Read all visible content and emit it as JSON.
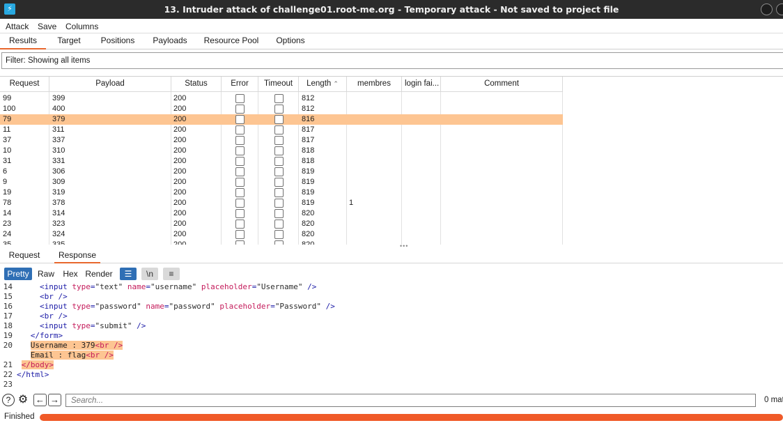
{
  "window": {
    "title": "13. Intruder attack of challenge01.root-me.org - Temporary attack - Not saved to project file",
    "app_icon": "⚡"
  },
  "menu": [
    "Attack",
    "Save",
    "Columns"
  ],
  "tabs": [
    "Results",
    "Target",
    "Positions",
    "Payloads",
    "Resource Pool",
    "Options"
  ],
  "filter": {
    "label": "Filter: Showing all items"
  },
  "table": {
    "columns": [
      "Request",
      "Payload",
      "Status",
      "Error",
      "Timeout",
      "Length",
      "membres",
      "login fai...",
      "Comment"
    ],
    "sort_column": "Length",
    "sort_direction": "ascending",
    "rows": [
      {
        "request": "99",
        "payload": "399",
        "status": "200",
        "error": false,
        "timeout": false,
        "length": "812",
        "membres": "",
        "login": "",
        "comment": ""
      },
      {
        "request": "100",
        "payload": "400",
        "status": "200",
        "error": false,
        "timeout": false,
        "length": "812",
        "membres": "",
        "login": "",
        "comment": ""
      },
      {
        "request": "79",
        "payload": "379",
        "status": "200",
        "error": false,
        "timeout": false,
        "length": "816",
        "membres": "",
        "login": "",
        "comment": "",
        "selected": true
      },
      {
        "request": "11",
        "payload": "311",
        "status": "200",
        "error": false,
        "timeout": false,
        "length": "817",
        "membres": "",
        "login": "",
        "comment": ""
      },
      {
        "request": "37",
        "payload": "337",
        "status": "200",
        "error": false,
        "timeout": false,
        "length": "817",
        "membres": "",
        "login": "",
        "comment": ""
      },
      {
        "request": "10",
        "payload": "310",
        "status": "200",
        "error": false,
        "timeout": false,
        "length": "818",
        "membres": "",
        "login": "",
        "comment": ""
      },
      {
        "request": "31",
        "payload": "331",
        "status": "200",
        "error": false,
        "timeout": false,
        "length": "818",
        "membres": "",
        "login": "",
        "comment": ""
      },
      {
        "request": "6",
        "payload": "306",
        "status": "200",
        "error": false,
        "timeout": false,
        "length": "819",
        "membres": "",
        "login": "",
        "comment": ""
      },
      {
        "request": "9",
        "payload": "309",
        "status": "200",
        "error": false,
        "timeout": false,
        "length": "819",
        "membres": "",
        "login": "",
        "comment": ""
      },
      {
        "request": "19",
        "payload": "319",
        "status": "200",
        "error": false,
        "timeout": false,
        "length": "819",
        "membres": "",
        "login": "",
        "comment": ""
      },
      {
        "request": "78",
        "payload": "378",
        "status": "200",
        "error": false,
        "timeout": false,
        "length": "819",
        "membres": "1",
        "login": "",
        "comment": ""
      },
      {
        "request": "14",
        "payload": "314",
        "status": "200",
        "error": false,
        "timeout": false,
        "length": "820",
        "membres": "",
        "login": "",
        "comment": ""
      },
      {
        "request": "23",
        "payload": "323",
        "status": "200",
        "error": false,
        "timeout": false,
        "length": "820",
        "membres": "",
        "login": "",
        "comment": ""
      },
      {
        "request": "24",
        "payload": "324",
        "status": "200",
        "error": false,
        "timeout": false,
        "length": "820",
        "membres": "",
        "login": "",
        "comment": ""
      },
      {
        "request": "35",
        "payload": "335",
        "status": "200",
        "error": false,
        "timeout": false,
        "length": "820",
        "membres": "",
        "login": "",
        "comment": ""
      }
    ]
  },
  "detail_tabs": [
    "Request",
    "Response"
  ],
  "view_modes": [
    "Pretty",
    "Raw",
    "Hex",
    "Render"
  ],
  "view_icons": [
    "wrap-lines-icon",
    "newline-icon",
    "menu-icon"
  ],
  "view_icon_glyphs": [
    "☰",
    "\\n",
    "≡"
  ],
  "code_lines": [
    {
      "n": "14",
      "indent": "     ",
      "segments": [
        [
          "tag",
          "<input "
        ],
        [
          "attr",
          "type"
        ],
        [
          "tag",
          "="
        ],
        [
          "str",
          "\"text\" "
        ],
        [
          "attr",
          "name"
        ],
        [
          "tag",
          "="
        ],
        [
          "str",
          "\"username\" "
        ],
        [
          "attr",
          "placeholder"
        ],
        [
          "tag",
          "="
        ],
        [
          "str",
          "\"Username\" "
        ],
        [
          "tag",
          "/>"
        ]
      ]
    },
    {
      "n": "15",
      "indent": "     ",
      "segments": [
        [
          "tag",
          "<br />"
        ]
      ]
    },
    {
      "n": "16",
      "indent": "     ",
      "segments": [
        [
          "tag",
          "<input "
        ],
        [
          "attr",
          "type"
        ],
        [
          "tag",
          "="
        ],
        [
          "str",
          "\"password\" "
        ],
        [
          "attr",
          "name"
        ],
        [
          "tag",
          "="
        ],
        [
          "str",
          "\"password\" "
        ],
        [
          "attr",
          "placeholder"
        ],
        [
          "tag",
          "="
        ],
        [
          "str",
          "\"Password\" "
        ],
        [
          "tag",
          "/>"
        ]
      ]
    },
    {
      "n": "17",
      "indent": "     ",
      "segments": [
        [
          "tag",
          "<br />"
        ]
      ]
    },
    {
      "n": "18",
      "indent": "     ",
      "segments": [
        [
          "tag",
          "<input "
        ],
        [
          "attr",
          "type"
        ],
        [
          "tag",
          "="
        ],
        [
          "str",
          "\"submit\" "
        ],
        [
          "tag",
          "/>"
        ]
      ]
    },
    {
      "n": "19",
      "indent": "   ",
      "segments": [
        [
          "tag",
          "</form>"
        ]
      ]
    },
    {
      "n": "20",
      "indent": "   ",
      "highlight": true,
      "segments": [
        [
          "txt",
          "Username : 379"
        ],
        [
          "attr",
          "<br />"
        ]
      ]
    },
    {
      "n": "",
      "indent": "   ",
      "highlight": true,
      "segments": [
        [
          "txt",
          "Email : flag"
        ],
        [
          "attr",
          "<br />"
        ]
      ]
    },
    {
      "n": "21",
      "indent": " ",
      "highlight": true,
      "segments": [
        [
          "attr",
          "</body>"
        ]
      ]
    },
    {
      "n": "22",
      "indent": "",
      "segments": [
        [
          "tag",
          "</html>"
        ]
      ]
    },
    {
      "n": "23",
      "indent": "",
      "segments": []
    }
  ],
  "search": {
    "placeholder": "Search...",
    "matches": "0 mat"
  },
  "status": {
    "text": "Finished",
    "progress": 1.0
  }
}
